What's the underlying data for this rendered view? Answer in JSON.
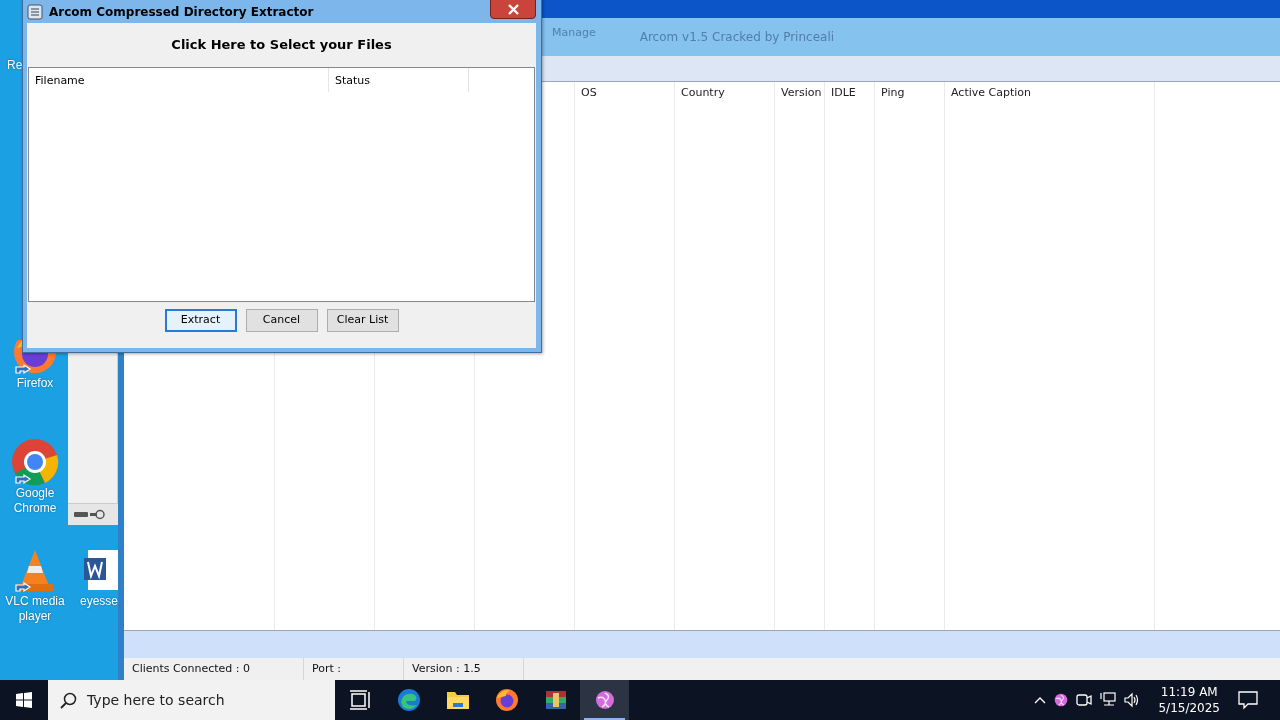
{
  "desktop": {
    "icons": [
      {
        "kind": "recycle",
        "label": "Re"
      },
      {
        "kind": "firefox",
        "label": "Firefox"
      },
      {
        "kind": "chrome",
        "label": "Google Chrome"
      },
      {
        "kind": "vlc",
        "label": "VLC media player"
      },
      {
        "kind": "word",
        "label": "eyesse"
      }
    ]
  },
  "main_window": {
    "title": "Arcom v1.5 Cracked by Princeali",
    "ribbon_tab": "Manage",
    "table": {
      "columns": [
        "OS",
        "Country",
        "Version",
        "IDLE",
        "Ping",
        "Active Caption"
      ]
    },
    "status_bar": [
      "Clients Connected : 0",
      "Port :",
      "Version : 1.5"
    ]
  },
  "dialog": {
    "title": "Arcom Compressed Directory Extractor",
    "heading": "Click Here to Select your Files",
    "columns": [
      "Filename",
      "Status"
    ],
    "buttons": [
      {
        "label": "Extract",
        "focused": true
      },
      {
        "label": "Cancel",
        "focused": false
      },
      {
        "label": "Clear List",
        "focused": false
      }
    ]
  },
  "taskbar": {
    "search_placeholder": "Type here to search",
    "apps": [
      {
        "kind": "task-view",
        "selected": false
      },
      {
        "kind": "edge",
        "selected": false
      },
      {
        "kind": "explorer",
        "selected": false
      },
      {
        "kind": "firefox",
        "selected": false
      },
      {
        "kind": "winrar",
        "selected": false
      },
      {
        "kind": "arcom",
        "selected": true
      }
    ],
    "tray": [
      {
        "kind": "chevron"
      },
      {
        "kind": "arcom"
      },
      {
        "kind": "meet"
      },
      {
        "kind": "network"
      },
      {
        "kind": "volume"
      }
    ],
    "time": "11:19 AM",
    "date": "5/15/2025"
  }
}
